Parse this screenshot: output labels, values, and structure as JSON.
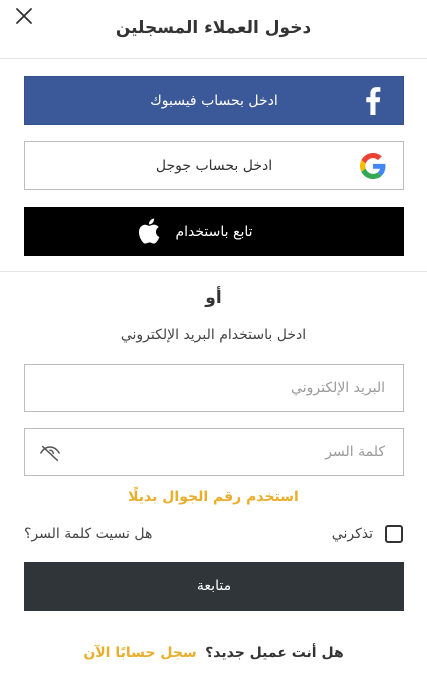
{
  "header": {
    "title": "دخول العملاء المسجلين",
    "close_icon": "close-icon"
  },
  "social": {
    "facebook": {
      "label": "ادخل بحساب فيسبوك",
      "icon": "facebook-icon",
      "color": "#3b5998"
    },
    "google": {
      "label": "ادخل بحساب جوجل",
      "icon": "google-icon"
    },
    "apple": {
      "label": "تابع باستخدام",
      "icon": "apple-icon",
      "color": "#000000"
    }
  },
  "divider_text": "أو",
  "email_hint": "ادخل باستخدام البريد الإلكتروني",
  "form": {
    "email": {
      "placeholder": "البريد الإلكتروني",
      "value": ""
    },
    "password": {
      "placeholder": "كلمة السر",
      "value": "",
      "icon": "eye-off-icon"
    },
    "mobile_link": "استخدم رقم الجوال بديلًا",
    "remember_me": {
      "label": "تذكرني",
      "checked": false
    },
    "forgot_password": "هل نسيت كلمة السر؟",
    "submit_label": "متابعة"
  },
  "signup": {
    "question": "هل أنت عميل جديد؟",
    "link": "سجل حسابًا الآن"
  },
  "colors": {
    "accent": "#e9ae2c",
    "submit_bg": "#30353a",
    "border": "#bdbdbd"
  }
}
